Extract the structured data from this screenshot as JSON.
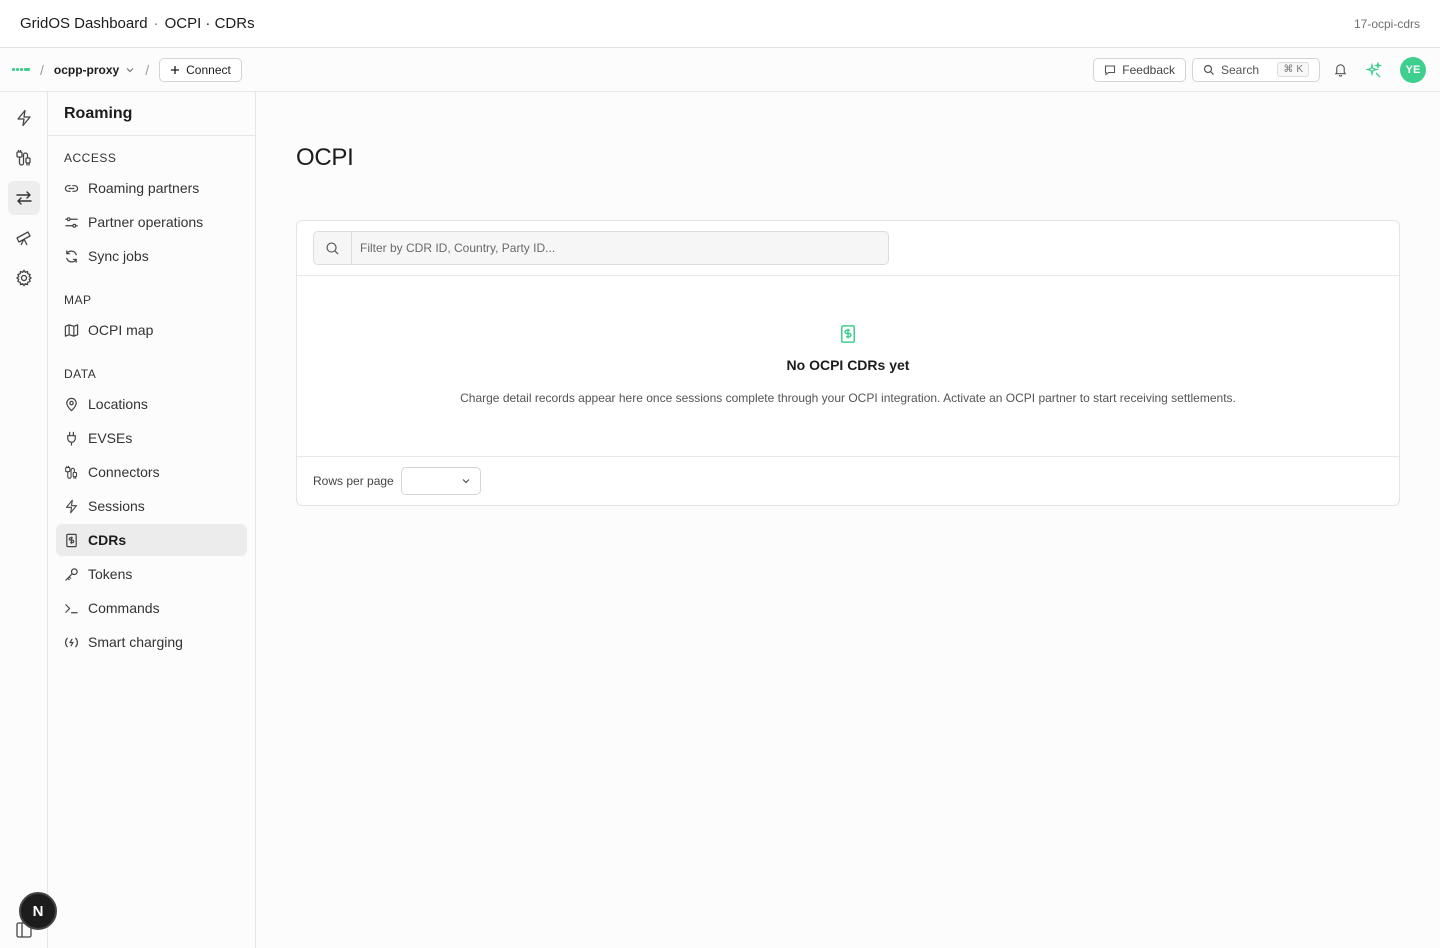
{
  "window": {
    "app_title": "GridOS Dashboard",
    "page_path": "OCPI · CDRs",
    "slug": "17-ocpi-cdrs"
  },
  "topbar": {
    "breadcrumb_sep": "/",
    "project": "ocpp-proxy",
    "connect_label": "Connect",
    "feedback_label": "Feedback",
    "search_label": "Search",
    "search_kbd_1": "⌘",
    "search_kbd_2": "K",
    "avatar_initials": "YE"
  },
  "sidebar": {
    "title": "Roaming",
    "sections": [
      {
        "label": "ACCESS",
        "items": [
          {
            "label": "Roaming partners",
            "icon": "link-icon"
          },
          {
            "label": "Partner operations",
            "icon": "sliders-icon"
          },
          {
            "label": "Sync jobs",
            "icon": "refresh-icon"
          }
        ]
      },
      {
        "label": "MAP",
        "items": [
          {
            "label": "OCPI map",
            "icon": "map-icon"
          }
        ]
      },
      {
        "label": "DATA",
        "items": [
          {
            "label": "Locations",
            "icon": "map-pin-icon"
          },
          {
            "label": "EVSEs",
            "icon": "plug-icon"
          },
          {
            "label": "Connectors",
            "icon": "cable-icon"
          },
          {
            "label": "Sessions",
            "icon": "bolt-icon"
          },
          {
            "label": "CDRs",
            "icon": "receipt-icon",
            "active": true
          },
          {
            "label": "Tokens",
            "icon": "key-icon"
          },
          {
            "label": "Commands",
            "icon": "terminal-icon"
          },
          {
            "label": "Smart charging",
            "icon": "signal-icon"
          }
        ]
      }
    ]
  },
  "rail": {
    "n_button": "N"
  },
  "main": {
    "title": "OCPI",
    "filter_placeholder": "Filter by CDR ID, Country, Party ID...",
    "empty_title": "No OCPI CDRs yet",
    "empty_description": "Charge detail records appear here once sessions complete through your OCPI integration. Activate an OCPI partner to start receiving settlements.",
    "rows_per_page_label": "Rows per page",
    "rows_per_page_value": ""
  },
  "colors": {
    "accent": "#3ecf8e",
    "text": "#1c1c1c",
    "border": "#e4e4e4"
  }
}
